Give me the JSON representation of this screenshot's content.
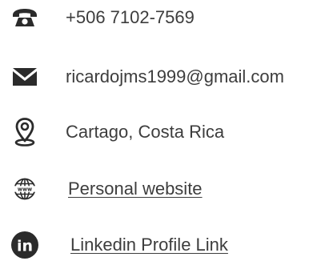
{
  "contact": {
    "phone": {
      "icon": "phone-icon",
      "text": "+506 7102-7569"
    },
    "email": {
      "icon": "envelope-icon",
      "text": "ricardojms1999@gmail.com"
    },
    "location": {
      "icon": "location-pin-icon",
      "text": "Cartago, Costa Rica"
    },
    "website": {
      "icon": "globe-www-icon",
      "text": "Personal website"
    },
    "linkedin": {
      "icon": "linkedin-icon",
      "text": "Linkedin Profile Link"
    }
  },
  "colors": {
    "icon": "#2b2b2b",
    "text": "#3d3d3d",
    "background": "#ffffff"
  }
}
